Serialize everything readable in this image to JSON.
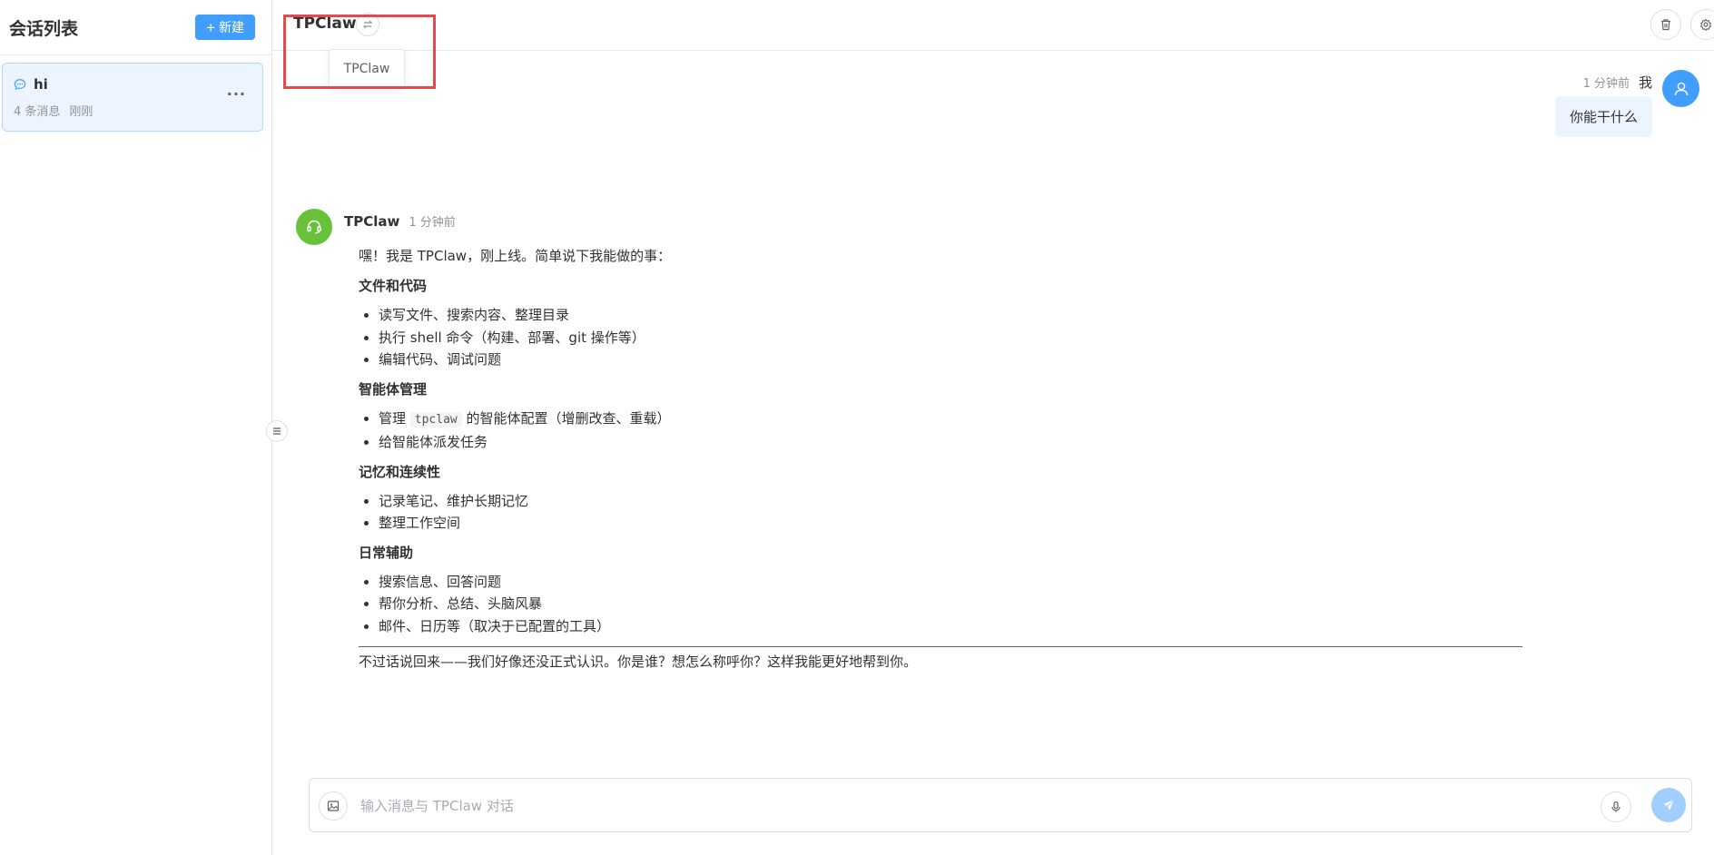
{
  "sidebar": {
    "title": "会话列表",
    "new_button_label": "新建",
    "sessions": [
      {
        "title": "hi",
        "message_count": "4 条消息",
        "time": "刚刚"
      }
    ]
  },
  "header": {
    "agent_name": "TPClaw",
    "tooltip": "TPClaw"
  },
  "messages": {
    "user": {
      "name": "我",
      "time": "1 分钟前",
      "text": "你能干什么"
    },
    "bot": {
      "name": "TPClaw",
      "time": "1 分钟前",
      "intro": "嘿！我是 TPClaw，刚上线。简单说下我能做的事：",
      "sections": [
        {
          "heading": "文件和代码",
          "items": [
            "读写文件、搜索内容、整理目录",
            "执行 shell 命令（构建、部署、git 操作等）",
            "编辑代码、调试问题"
          ]
        },
        {
          "heading": "智能体管理",
          "items_special": {
            "prefix": "管理 ",
            "code": "tpclaw",
            "suffix": " 的智能体配置（增删改查、重载）"
          },
          "items": [
            "给智能体派发任务"
          ]
        },
        {
          "heading": "记忆和连续性",
          "items": [
            "记录笔记、维护长期记忆",
            "整理工作空间"
          ]
        },
        {
          "heading": "日常辅助",
          "items": [
            "搜索信息、回答问题",
            "帮你分析、总结、头脑风暴",
            "邮件、日历等（取决于已配置的工具）"
          ]
        }
      ],
      "closing": "不过话说回来——我们好像还没正式认识。你是谁？想怎么称呼你？这样我能更好地帮到你。"
    }
  },
  "input": {
    "placeholder": "输入消息与 TPClaw 对话",
    "value": ""
  },
  "colors": {
    "primary": "#409eff",
    "bot_avatar": "#67c23a",
    "highlight": "#e5484d",
    "selected_session_bg": "#ecf5ff"
  }
}
